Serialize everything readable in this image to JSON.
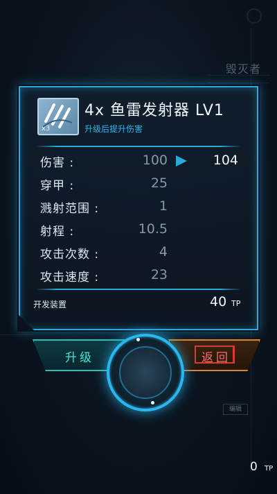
{
  "background": {
    "title": "毁灭者",
    "small_button": "编辑"
  },
  "item": {
    "icon": "torpedo-launcher-icon",
    "icon_badge": "x3",
    "title": "4x 鱼雷发射器 LV1",
    "description": "升级后提升伤害"
  },
  "stats": [
    {
      "label": "伤害 :",
      "value": "100",
      "next": "104"
    },
    {
      "label": "穿甲 :",
      "value": "25"
    },
    {
      "label": "溅射范围 :",
      "value": "1"
    },
    {
      "label": "射程 :",
      "value": "10.5"
    },
    {
      "label": "攻击次数 :",
      "value": "4"
    },
    {
      "label": "攻击速度 :",
      "value": "23"
    }
  ],
  "dev_device": {
    "label": "开发装置",
    "value": "40",
    "unit": "TP"
  },
  "buttons": {
    "upgrade": "升级",
    "back": "返回"
  },
  "tp_counter": {
    "value": "0",
    "unit": "TP"
  },
  "colors": {
    "accent": "#2aa9dd",
    "upgrade": "#3ee6d8",
    "back": "#ff6a6a"
  }
}
